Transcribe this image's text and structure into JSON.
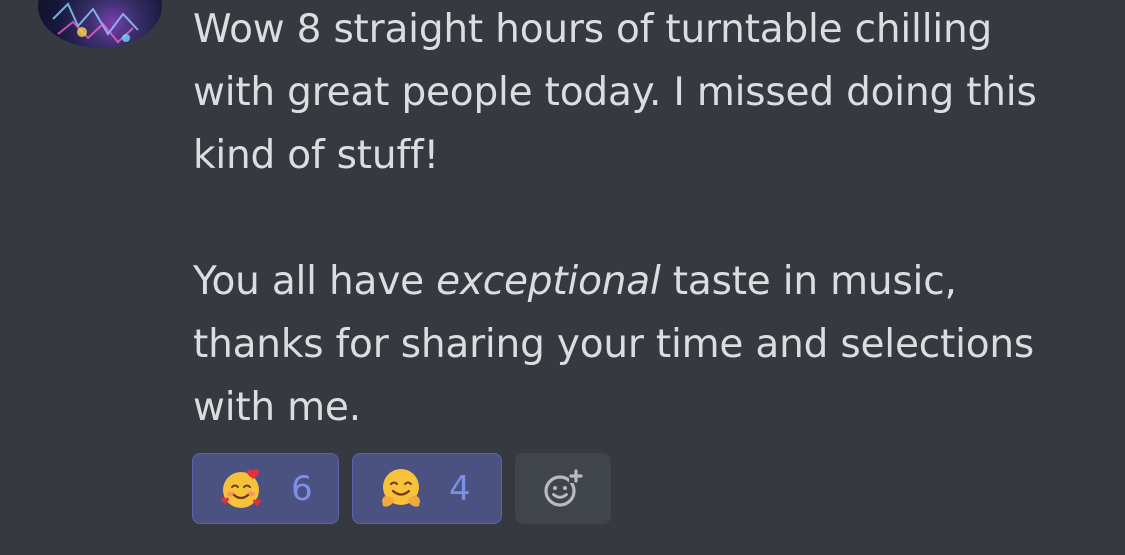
{
  "message": {
    "line1": "Wow 8 straight hours of turntable chilling",
    "line2": "with great people today. I missed doing this",
    "line3": "kind of stuff!",
    "line4_before": "You all have ",
    "line4_em": "exceptional",
    "line4_after": " taste in music,",
    "line5": "thanks for sharing your time and selections",
    "line6": "with me."
  },
  "reactions": [
    {
      "emoji": "smiling-face-with-hearts-icon",
      "count": "6",
      "reacted": true
    },
    {
      "emoji": "hugging-face-icon",
      "count": "4",
      "reacted": true
    }
  ],
  "add_reaction_icon": "add-reaction-icon",
  "colors": {
    "background": "#36393f",
    "text": "#dcddde",
    "reaction_active_bg": "#4b5180",
    "reaction_count": "#7d90e8",
    "add_reaction_bg": "#40444b"
  }
}
